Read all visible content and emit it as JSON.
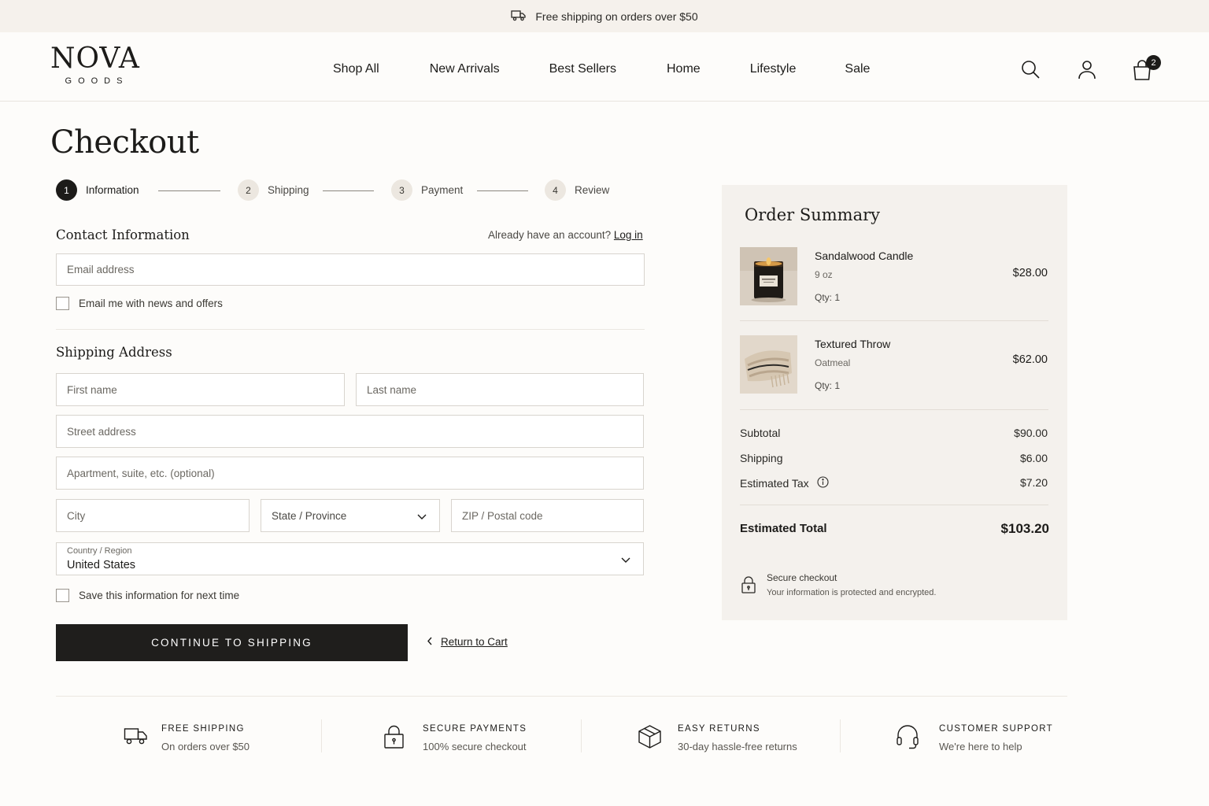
{
  "announcement": {
    "text": "Free shipping on orders over $50",
    "icon": "truck-icon"
  },
  "brand": {
    "name": "NOVA",
    "tagline": "GOODS"
  },
  "nav": [
    {
      "label": "Shop All"
    },
    {
      "label": "New Arrivals"
    },
    {
      "label": "Best Sellers"
    },
    {
      "label": "Home"
    },
    {
      "label": "Lifestyle"
    },
    {
      "label": "Sale"
    }
  ],
  "header_icons": {
    "search": "search-icon",
    "account": "user-icon",
    "cart": "shopping-bag-icon",
    "cart_count": "2"
  },
  "page": {
    "title": "Checkout"
  },
  "steps": [
    {
      "num": "1",
      "label": "Information",
      "active": true
    },
    {
      "num": "2",
      "label": "Shipping",
      "active": false
    },
    {
      "num": "3",
      "label": "Payment",
      "active": false
    },
    {
      "num": "4",
      "label": "Review",
      "active": false
    }
  ],
  "contact": {
    "title": "Contact Information",
    "account_prompt": "Already have an account?",
    "login_link": "Log in",
    "email_placeholder": "Email address",
    "newsletter_label": "Email me with news and offers"
  },
  "shipping": {
    "title": "Shipping Address",
    "first_name_placeholder": "First name",
    "last_name_placeholder": "Last name",
    "street_placeholder": "Street address",
    "apartment_placeholder": "Apartment, suite, etc. (optional)",
    "city_placeholder": "City",
    "state_placeholder": "State / Province",
    "zip_placeholder": "ZIP / Postal code",
    "country_label": "Country / Region",
    "country_value": "United States",
    "save_label": "Save this information for next time"
  },
  "actions": {
    "continue_label": "CONTINUE TO SHIPPING",
    "return_label": "Return to Cart"
  },
  "summary": {
    "title": "Order Summary",
    "items": [
      {
        "name": "Sandalwood Candle",
        "variant": "9 oz",
        "qty": "Qty: 1",
        "price": "$28.00"
      },
      {
        "name": "Textured Throw",
        "variant": "Oatmeal",
        "qty": "Qty: 1",
        "price": "$62.00"
      }
    ],
    "subtotal_label": "Subtotal",
    "subtotal": "$90.00",
    "shipping_label": "Shipping",
    "shipping": "$6.00",
    "tax_label": "Estimated Tax",
    "tax": "$7.20",
    "total_label": "Estimated Total",
    "total": "$103.20",
    "secure_title": "Secure checkout",
    "secure_sub": "Your information is protected and encrypted."
  },
  "features": [
    {
      "title": "FREE SHIPPING",
      "sub": "On orders over $50",
      "icon": "truck-icon"
    },
    {
      "title": "SECURE PAYMENTS",
      "sub": "100% secure checkout",
      "icon": "lock-icon"
    },
    {
      "title": "EASY RETURNS",
      "sub": "30-day hassle-free returns",
      "icon": "box-icon"
    },
    {
      "title": "CUSTOMER SUPPORT",
      "sub": "We're here to help",
      "icon": "headset-icon"
    }
  ]
}
